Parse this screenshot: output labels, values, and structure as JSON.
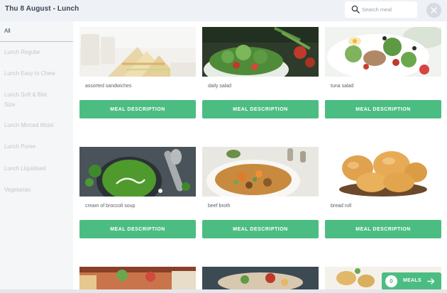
{
  "header": {
    "title": "Thu 8 August - Lunch",
    "search_placeholder": "Search meal"
  },
  "sidebar": {
    "items": [
      {
        "label": "All",
        "active": true
      },
      {
        "label": "Lunch Regular",
        "active": false
      },
      {
        "label": "Lunch Easy to Chew",
        "active": false
      },
      {
        "label_line1": "Lunch Soft & Bite",
        "label_line2": "Size",
        "active": false
      },
      {
        "label": "Lunch Minced Moist",
        "active": false
      },
      {
        "label": "Lunch Puree",
        "active": false
      },
      {
        "label": "Lunch Liquidised",
        "active": false
      },
      {
        "label": "Vegetarian",
        "active": false
      }
    ]
  },
  "meals": [
    {
      "name": "assorted sandwiches",
      "button": "MEAL DESCRIPTION"
    },
    {
      "name": "daily salad",
      "button": "MEAL DESCRIPTION"
    },
    {
      "name": "tuna salad",
      "button": "MEAL DESCRIPTION"
    },
    {
      "name": "cream of broccoli soup",
      "button": "MEAL DESCRIPTION"
    },
    {
      "name": "beef broth",
      "button": "MEAL DESCRIPTION"
    },
    {
      "name": "bread roll",
      "button": "MEAL DESCRIPTION"
    }
  ],
  "cart": {
    "count": "0",
    "label": "MEALS"
  },
  "colors": {
    "accent": "#4cbd82",
    "header_bg": "#eef2f6",
    "sidebar_bg": "#f4f6f8"
  }
}
